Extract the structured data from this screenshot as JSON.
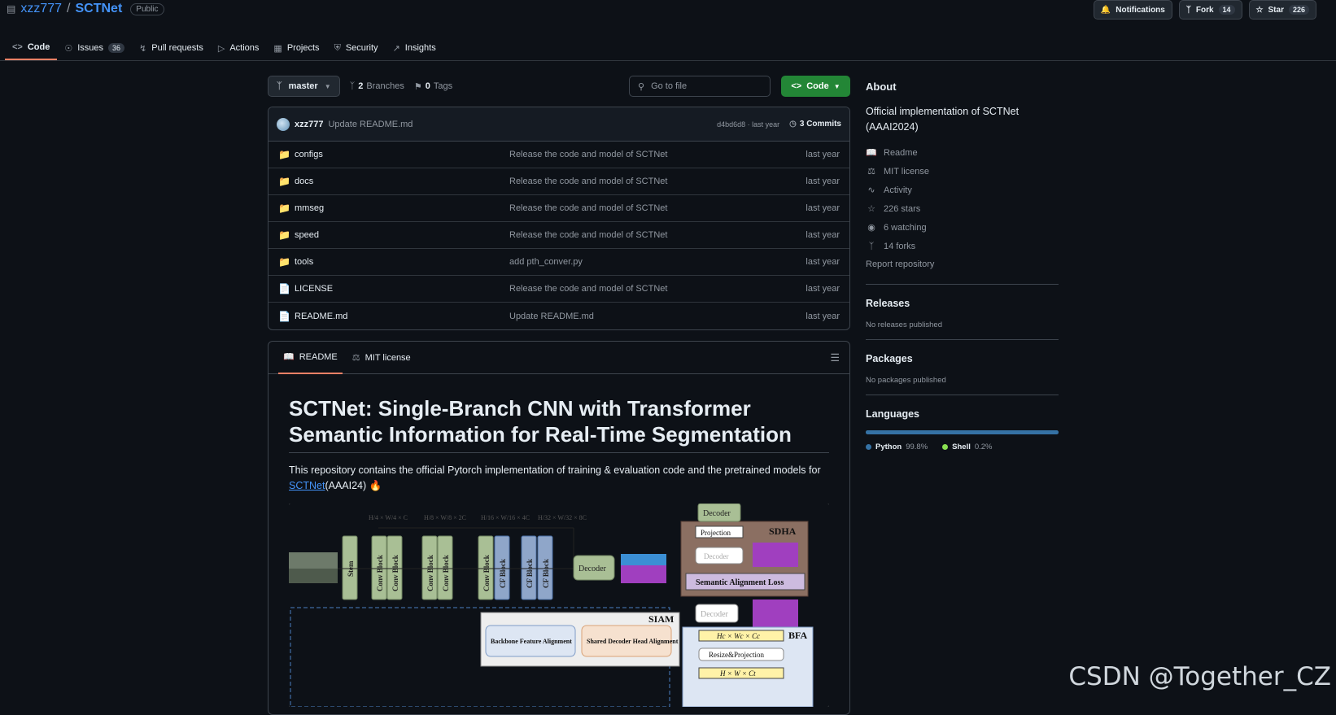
{
  "repo": {
    "owner": "xzz777",
    "separator": "/",
    "name": "SCTNet",
    "visibility": "Public"
  },
  "actions": {
    "notifications": "Notifications",
    "fork": "Fork",
    "fork_count": "14",
    "star": "Star",
    "star_count": "226"
  },
  "tabs": [
    {
      "label": "Code",
      "icon": "code-icon"
    },
    {
      "label": "Issues",
      "icon": "issue-icon",
      "count": "36"
    },
    {
      "label": "Pull requests",
      "icon": "pull-request-icon"
    },
    {
      "label": "Actions",
      "icon": "play-icon"
    },
    {
      "label": "Projects",
      "icon": "table-icon"
    },
    {
      "label": "Security",
      "icon": "shield-icon"
    },
    {
      "label": "Insights",
      "icon": "graph-icon"
    }
  ],
  "filebar": {
    "branch": "master",
    "branches_count": "2",
    "branches_label": "Branches",
    "tags_count": "0",
    "tags_label": "Tags",
    "goto_placeholder": "Go to file",
    "code_label": "Code"
  },
  "latest_commit": {
    "user": "xzz777",
    "message": "Update README.md",
    "hash_time": "d4bd6d8 · last year",
    "commits": "3 Commits"
  },
  "files": [
    {
      "name": "configs",
      "type": "folder",
      "commit": "Release the code and model of SCTNet",
      "age": "last year"
    },
    {
      "name": "docs",
      "type": "folder",
      "commit": "Release the code and model of SCTNet",
      "age": "last year"
    },
    {
      "name": "mmseg",
      "type": "folder",
      "commit": "Release the code and model of SCTNet",
      "age": "last year"
    },
    {
      "name": "speed",
      "type": "folder",
      "commit": "Release the code and model of SCTNet",
      "age": "last year"
    },
    {
      "name": "tools",
      "type": "folder",
      "commit": "add pth_conver.py",
      "age": "last year"
    },
    {
      "name": "LICENSE",
      "type": "file",
      "commit": "Release the code and model of SCTNet",
      "age": "last year"
    },
    {
      "name": "README.md",
      "type": "file",
      "commit": "Update README.md",
      "age": "last year"
    }
  ],
  "readme": {
    "tab_readme": "README",
    "tab_license": "MIT license",
    "title": "SCTNet: Single-Branch CNN with Transformer Semantic Information for Real-Time Segmentation",
    "para_prefix": "This repository contains the official Pytorch implementation of training & evaluation code and the pretrained models for ",
    "para_link": "SCTNet",
    "para_suffix": "(AAAI24)",
    "figure": {
      "stem": "Stem",
      "conv_block": "Conv Block",
      "cf_block": "CF Block",
      "decoder": "Decoder",
      "projection": "Projection",
      "sdha": "SDHA",
      "semantic_alignment_loss": "Semantic Alignment Loss",
      "siam": "SIAM",
      "backbone_feature_alignment": "Backbone Feature Alignment",
      "shared_decoder_head_alignment": "Shared Decoder Head Alignment",
      "bfa": "BFA",
      "resize_projection": "Resize&Projection",
      "dim_c": "Hc × Wc × Cc",
      "dim_t": "H × W × Ct",
      "sizes": [
        "H/4 × W/4 × C",
        "H/8 × W/8 × 2C",
        "H/16 × W/16 × 4C",
        "H/32 × W/32 × 8C"
      ]
    }
  },
  "about": {
    "heading": "About",
    "description": "Official implementation of SCTNet (AAAI2024)",
    "items": [
      {
        "label": "Readme",
        "icon": "book-icon"
      },
      {
        "label": "MIT license",
        "icon": "law-icon"
      },
      {
        "label": "Activity",
        "icon": "pulse-icon"
      },
      {
        "label": "226 stars",
        "icon": "star-icon"
      },
      {
        "label": "6 watching",
        "icon": "eye-icon"
      },
      {
        "label": "14 forks",
        "icon": "fork-icon"
      }
    ],
    "report": "Report repository"
  },
  "releases": {
    "heading": "Releases",
    "empty": "No releases published"
  },
  "packages": {
    "heading": "Packages",
    "empty": "No packages published"
  },
  "languages": {
    "heading": "Languages",
    "items": [
      {
        "name": "Python",
        "pct": "99.8%",
        "value": 99.8,
        "color": "#3572A5"
      },
      {
        "name": "Shell",
        "pct": "0.2%",
        "value": 0.2,
        "color": "#89e051"
      }
    ]
  },
  "watermark": "CSDN @Together_CZ",
  "colors": {
    "accent_blue": "#4493f8",
    "tab_underline": "#f78166",
    "code_button": "#238636"
  }
}
